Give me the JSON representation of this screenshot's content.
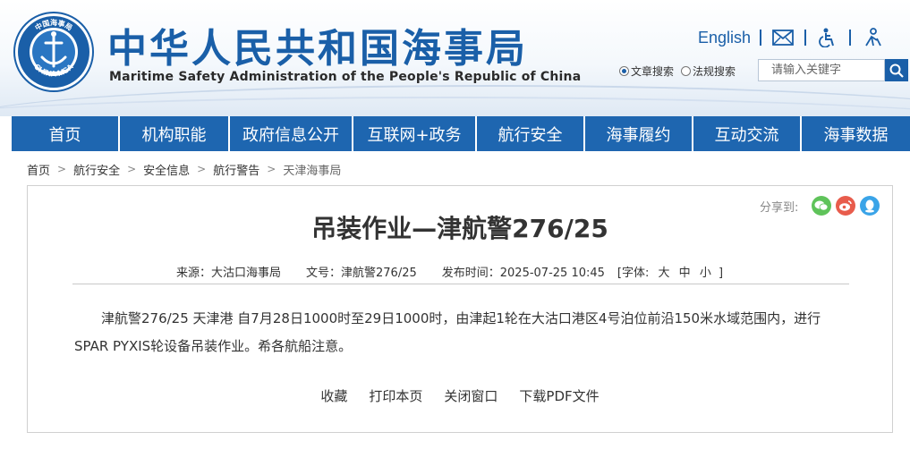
{
  "header": {
    "logo_text_top": "中国海事局",
    "logo_text_bottom": "CHINA MSA",
    "title": "中华人民共和国海事局",
    "subtitle": "Maritime Safety Administration of the People's Republic of China",
    "english_link": "English",
    "icons": [
      "mail-icon",
      "accessibility-icon",
      "elder-care-icon"
    ],
    "search": {
      "options": [
        "文章搜索",
        "法规搜索"
      ],
      "selected": "文章搜索",
      "placeholder": "请输入关键字"
    }
  },
  "nav": {
    "items": [
      "首页",
      "机构职能",
      "政府信息公开",
      "互联网+政务",
      "航行安全",
      "海事履约",
      "互动交流",
      "海事数据"
    ]
  },
  "breadcrumb": [
    "首页",
    "航行安全",
    "安全信息",
    "航行警告",
    "天津海事局"
  ],
  "article": {
    "share_label": "分享到:",
    "share_icons": [
      "wechat-icon",
      "weibo-icon",
      "qq-icon"
    ],
    "title": "吊装作业—津航警276/25",
    "meta": {
      "source": "来源：大沽口海事局",
      "doc_no": "文号：津航警276/25",
      "published": "发布时间：2025-07-25 10:45",
      "font_size_label": "[字体:",
      "font_sizes": [
        "大",
        "中",
        "小"
      ],
      "font_size_close": "]"
    },
    "body": "津航警276/25 天津港 自7月28日1000时至29日1000时，由津起1轮在大沽口港区4号泊位前沿150米水域范围内，进行SPAR PYXIS轮设备吊装作业。希各航船注意。",
    "actions": [
      "收藏",
      "打印本页",
      "关闭窗口",
      "下载PDF文件"
    ]
  },
  "colors": {
    "brand_blue": "#1e66b0",
    "title_blue": "#1a5fa8",
    "wechat": "#5fc35a",
    "weibo": "#e85c4c",
    "qq": "#3aa4e8"
  }
}
